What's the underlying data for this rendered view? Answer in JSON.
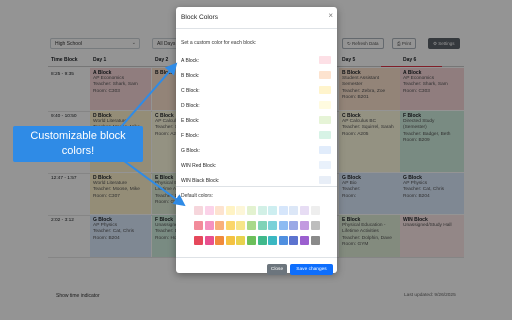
{
  "toolbar": {
    "school_select": "High School",
    "days_select": "All Days",
    "refresh_label": "Refresh Data",
    "print_label": "Print",
    "settings_label": "Settings"
  },
  "schedule": {
    "headers": [
      "Time Block",
      "Day 1",
      "Day 2",
      "Day 5",
      "Day 6"
    ],
    "times": [
      "8:25 - 9:35",
      "9:40 - 10:50",
      "12:47 - 1:57",
      "2:02 - 3:12"
    ],
    "cells": [
      {
        "title": "A Block",
        "lines": [
          "AP Economics",
          "Teacher: Shark, Sam",
          "Room: C303"
        ],
        "color": "#f8d7da"
      },
      {
        "title": "B Block",
        "lines": [
          "",
          "",
          ""
        ],
        "color": "#fde3cf"
      },
      {
        "title": "B Block",
        "lines": [
          "Student Assistant",
          "Semester",
          "Teacher: Zebra, Zoe",
          "Room: B201"
        ],
        "color": "#fde3cf"
      },
      {
        "title": "A Block",
        "lines": [
          "AP Economics",
          "Teacher: Shark, Sam",
          "Room: C303"
        ],
        "color": "#f8d7da"
      },
      {
        "title": "D Block",
        "lines": [
          "World Literature",
          "Teacher: Moose, Mike",
          "Room: C307"
        ],
        "color": "#fff3cd"
      },
      {
        "title": "C Block",
        "lines": [
          "AP Calculus BC",
          "Teacher: Squirrel, Sarah",
          "Room: A205"
        ],
        "color": "#fffbe0"
      },
      {
        "title": "C Block",
        "lines": [
          "AP Calculus BC",
          "Teacher: Squirrel, Sarah",
          "Room: A205"
        ],
        "color": "#fffbe0"
      },
      {
        "title": "F Block",
        "lines": [
          "Directed Study",
          "(Semester)",
          "Teacher: Badger, Beth",
          "Room: B209"
        ],
        "color": "#d1f0e0"
      },
      {
        "title": "D Block",
        "lines": [
          "World Literature",
          "Teacher: Moose, Mike",
          "Room: C307"
        ],
        "color": "#fff3cd"
      },
      {
        "title": "E Block",
        "lines": [
          "Physical Education -",
          "Lifetime Activities",
          "Teacher: Dolphin, Dave",
          "Room: GYM"
        ],
        "color": "#e2f0d9"
      },
      {
        "title": "G Block",
        "lines": [
          "AP Bio",
          "Teacher:",
          "Room:"
        ],
        "color": "#dbeafe"
      },
      {
        "title": "G Block",
        "lines": [
          "AP Physics",
          "Teacher: Cat, Chris",
          "Room: B204"
        ],
        "color": "#dbeafe"
      },
      {
        "title": "G Block",
        "lines": [
          "AP Physics",
          "Teacher: Cat, Chris",
          "Room: B204"
        ],
        "color": "#dbeafe"
      },
      {
        "title": "F Block",
        "lines": [
          "Unassigned/Open Ends",
          "Teacher: Dog, Dan",
          "Room: Home"
        ],
        "color": "#d1f0e0"
      },
      {
        "title": "E Block",
        "lines": [
          "Physical Education -",
          "Lifetime Activities",
          "Teacher: Dolphin, Dave",
          "Room: GYM"
        ],
        "color": "#e2f0d9"
      },
      {
        "title": "WIN Block",
        "lines": [
          "Unassigned/Study Hall"
        ],
        "color": "#fde8e8"
      },
      {
        "title": "E Block",
        "lines": [
          "Physical Education -",
          "Lifetime Activities",
          "Teacher: Dolphin, Dave",
          "Room: GYM"
        ],
        "color": "#e2f0d9"
      }
    ],
    "day2_partial": [
      "Teacher:",
      "Room: C"
    ]
  },
  "footer": {
    "time_indicator": "Show time indicator",
    "last_updated": "Last updated: 9/26/2025"
  },
  "modal": {
    "title": "Block Colors",
    "close_icon": "×",
    "hint": "Set a custom color for each block:",
    "blocks": [
      {
        "label": "A Block:",
        "color": "#fde0e6"
      },
      {
        "label": "B Block:",
        "color": "#fde3cf"
      },
      {
        "label": "C Block:",
        "color": "#fff4cc"
      },
      {
        "label": "D Block:",
        "color": "#fffbe0"
      },
      {
        "label": "E Block:",
        "color": "#e6f4d7"
      },
      {
        "label": "F Block:",
        "color": "#d7f3e6"
      },
      {
        "label": "G Block:",
        "color": "#e1ecfb"
      },
      {
        "label": "WIN Red Block:",
        "color": "#e9f1fb"
      },
      {
        "label": "WIN Black Block:",
        "color": "#e8eef7"
      }
    ],
    "defaults_label": "Default colors:",
    "palette_rows": [
      [
        "#f6d6dc",
        "#fbd3e9",
        "#fde3cf",
        "#fff3c4",
        "#fdf6d8",
        "#e3f2d0",
        "#d2f0e6",
        "#cdeef0",
        "#d6e6fb",
        "#dce7f7",
        "#e7ddf4",
        "#eeeeee"
      ],
      [
        "#f28b9a",
        "#f592c0",
        "#f9b07a",
        "#fbd66a",
        "#f7e58a",
        "#a8d98a",
        "#7fd3b7",
        "#7bd1d8",
        "#8dbbf2",
        "#9aa9e6",
        "#c29ae0",
        "#bdbdbd"
      ],
      [
        "#e5485b",
        "#e8508f",
        "#f08a3c",
        "#f4c242",
        "#e8d24e",
        "#6cbf5a",
        "#40b98b",
        "#3bb8c2",
        "#4f8fe0",
        "#5c73cf",
        "#9b5fcf",
        "#8a8a8a"
      ]
    ],
    "close_button": "Close",
    "save_button": "Save changes"
  },
  "callout": {
    "line1": "Customizable block",
    "line2": "colors!",
    "color": "#2f8be6"
  }
}
